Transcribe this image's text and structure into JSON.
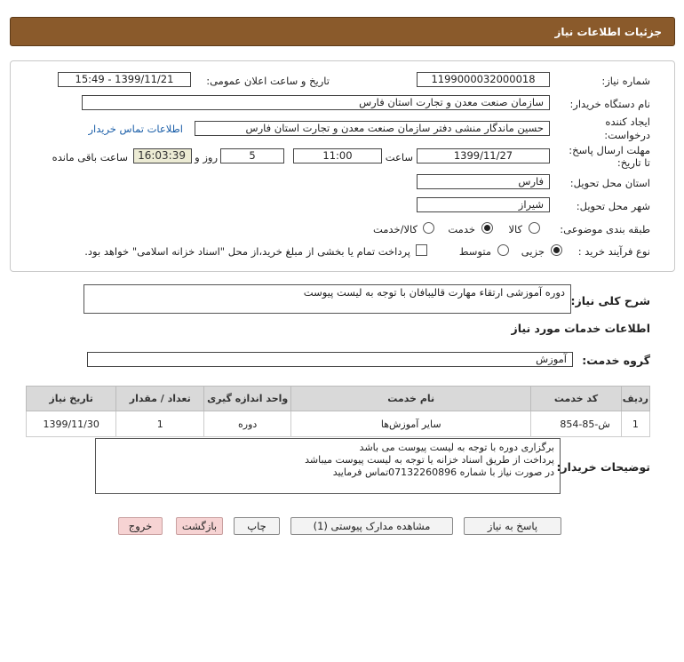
{
  "header": {
    "title": "جزئیات اطلاعات نیاز"
  },
  "form": {
    "need_number_label": "شماره نیاز:",
    "need_number": "1199000032000018",
    "announce_label": "تاریخ و ساعت اعلان عمومی:",
    "announce_value": "1399/11/21 - 15:49",
    "buyer_org_label": "نام دستگاه خریدار:",
    "buyer_org": "سازمان صنعت معدن و تجارت استان فارس",
    "creator_label_1": "ایجاد کننده",
    "creator_label_2": "درخواست:",
    "creator": "حسین ماندگار منشی دفتر  سازمان صنعت معدن و تجارت استان فارس",
    "contact_link": "اطلاعات تماس خریدار",
    "deadline_label_1": "مهلت ارسال پاسخ:",
    "deadline_label_2": "تا تاریخ:",
    "deadline_date": "1399/11/27",
    "time_label": "ساعت",
    "deadline_time": "11:00",
    "days_value": "5",
    "days_label": "روز و",
    "remaining_time": "16:03:39",
    "remaining_label": "ساعت باقی مانده",
    "province_label": "استان محل تحویل:",
    "province": "فارس",
    "city_label": "شهر محل تحویل:",
    "city": "شیراز",
    "category_label": "طبقه بندی موضوعی:",
    "category_options": [
      "کالا",
      "خدمت",
      "کالا/خدمت"
    ],
    "category_selected": "خدمت",
    "process_label": "نوع فرآیند خرید :",
    "process_options": [
      "جزیی",
      "متوسط"
    ],
    "process_selected": "جزیی",
    "treasury_text": "پرداخت تمام یا بخشی از مبلغ خرید،از محل \"اسناد خزانه اسلامی\" خواهد بود."
  },
  "summary": {
    "label": "شرح کلی نیاز:",
    "value": "دوره آموزشی ارتقاء مهارت قالیبافان با توجه به لیست پیوست"
  },
  "services": {
    "section_title": "اطلاعات خدمات مورد نیاز",
    "group_label": "گروه خدمت:",
    "group_value": "آموزش",
    "columns": [
      "ردیف",
      "کد خدمت",
      "نام خدمت",
      "واحد اندازه گیری",
      "تعداد / مقدار",
      "تاریخ نیاز"
    ],
    "rows": [
      [
        "1",
        "ش-85-854",
        "سایر آموزش‌ها",
        "دوره",
        "1",
        "1399/11/30"
      ]
    ]
  },
  "buyer_notes": {
    "label": "توضیحات خریدار:",
    "lines": [
      "برگزاری دوره با توجه به لیست پیوست می باشد",
      "پرداخت از طریق اسناد خزانه یا توجه به لیست پیوست میباشد",
      "در صورت نیاز با شماره 07132260896تماس فرمایید"
    ]
  },
  "buttons": {
    "reply": "پاسخ به نیاز",
    "attachments": "مشاهده مدارک پیوستی (1)",
    "print": "چاپ",
    "back": "بازگشت",
    "exit": "خروج"
  },
  "colors": {
    "header_bg": "#8a5a2b",
    "table_header_bg": "#d9d9d9",
    "pink_button": "#f6d3d3"
  }
}
